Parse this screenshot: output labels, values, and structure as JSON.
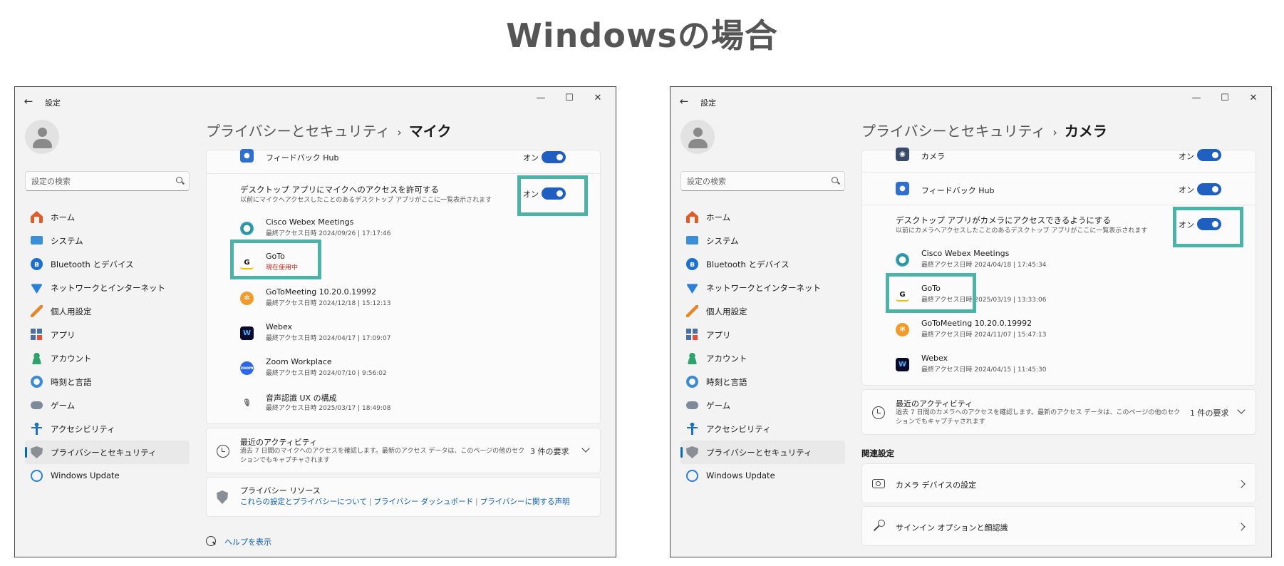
{
  "heading": "Windowsの場合",
  "window": {
    "title": "設定",
    "controls": {
      "minimize": "—",
      "maximize": "☐",
      "close": "✕"
    }
  },
  "search": {
    "placeholder": "設定の検索"
  },
  "nav": [
    {
      "label": "ホーム",
      "icon": "home-icon"
    },
    {
      "label": "システム",
      "icon": "system-icon"
    },
    {
      "label": "Bluetooth とデバイス",
      "icon": "bluetooth-icon"
    },
    {
      "label": "ネットワークとインターネット",
      "icon": "wifi-icon"
    },
    {
      "label": "個人用設定",
      "icon": "brush-icon"
    },
    {
      "label": "アプリ",
      "icon": "apps-icon"
    },
    {
      "label": "アカウント",
      "icon": "account-icon"
    },
    {
      "label": "時刻と言語",
      "icon": "globe-clock-icon"
    },
    {
      "label": "ゲーム",
      "icon": "gamepad-icon"
    },
    {
      "label": "アクセシビリティ",
      "icon": "accessibility-icon"
    },
    {
      "label": "プライバシーとセキュリティ",
      "icon": "shield-icon",
      "selected": true
    },
    {
      "label": "Windows Update",
      "icon": "update-icon"
    }
  ],
  "breadcrumb_parent": "プライバシーとセキュリティ",
  "breadcrumb_sep": "›",
  "toggle_on": "オン",
  "mic": {
    "current": "マイク",
    "feedback_hub": "フィードバック Hub",
    "desktop_title": "デスクトップ アプリにマイクへのアクセスを許可する",
    "desktop_sub": "以前にマイクへアクセスしたことのあるデスクトップ アプリがここに一覧表示されます",
    "apps": [
      {
        "name": "Cisco Webex Meetings",
        "sub": "最終アクセス日時 2024/09/26 | 17:17:46"
      },
      {
        "name": "GoTo",
        "sub": "現在使用中",
        "in_use": true
      },
      {
        "name": "GoToMeeting 10.20.0.19992",
        "sub": "最終アクセス日時 2024/12/18 | 15:12:13"
      },
      {
        "name": "Webex",
        "sub": "最終アクセス日時 2024/04/17 | 17:09:07"
      },
      {
        "name": "Zoom Workplace",
        "sub": "最終アクセス日時 2024/07/10 | 9:56:02"
      },
      {
        "name": "音声認識 UX の構成",
        "sub": "最終アクセス日時 2025/03/17 | 18:49:08"
      }
    ],
    "activity_title": "最近のアクティビティ",
    "activity_desc": "過去 7 日間のマイクへのアクセスを確認します。最新のアクセス データは、このページの他のセクションでもキャプチャされます",
    "activity_count": "3 件の要求",
    "privacy_title": "プライバシー リソース",
    "privacy_links": [
      "これらの設定とプライバシーについて",
      "プライバシー ダッシュボード",
      "プライバシーに関する声明"
    ],
    "help": "ヘルプを表示"
  },
  "camera": {
    "current": "カメラ",
    "camera_app": "カメラ",
    "feedback_hub": "フィードバック Hub",
    "desktop_title": "デスクトップ アプリがカメラにアクセスできるようにする",
    "desktop_sub": "以前にカメラへアクセスしたことのあるデスクトップ アプリがここに一覧表示されます",
    "apps": [
      {
        "name": "Cisco Webex Meetings",
        "sub": "最終アクセス日時 2024/04/18 | 17:45:34"
      },
      {
        "name": "GoTo",
        "sub": "最終アクセス日時 2025/03/19 | 13:33:06"
      },
      {
        "name": "GoToMeeting 10.20.0.19992",
        "sub": "最終アクセス日時 2024/11/07 | 15:47:13"
      },
      {
        "name": "Webex",
        "sub": "最終アクセス日時 2024/04/15 | 11:45:30"
      }
    ],
    "activity_title": "最近のアクティビティ",
    "activity_desc": "過去 7 日間のカメラへのアクセスを確認します。最新のアクセス データは、このページの他のセクションでもキャプチャされます",
    "activity_count": "1 件の要求",
    "related": "関連設定",
    "device_settings": "カメラ デバイスの設定",
    "signin_options": "サインイン オプションと顔認識"
  },
  "colors": {
    "toggle_on": "#1f5fc0",
    "highlight": "#4db3a9",
    "accent": "#0067c0",
    "in_use": "#c42b1c"
  }
}
